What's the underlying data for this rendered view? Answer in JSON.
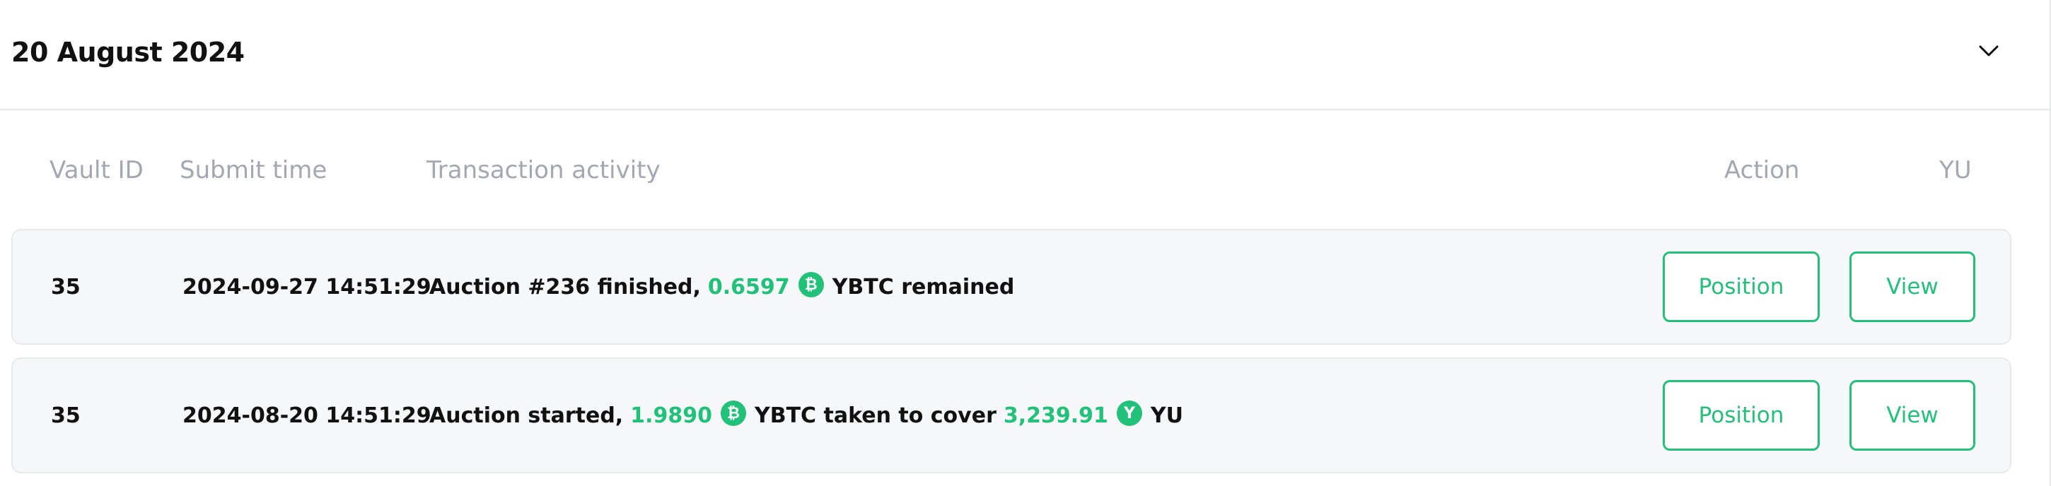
{
  "header": {
    "date": "20 August 2024",
    "toggle_icon": "chevron-down-icon"
  },
  "columns": {
    "vault_id": "Vault ID",
    "submit_time": "Submit time",
    "transaction_activity": "Transaction activity",
    "action": "Action",
    "yu": "YU"
  },
  "rows": [
    {
      "vault_id": "35",
      "submit_time": "2024-09-27 14:51:29",
      "activity": {
        "prefix": "Auction #236 finished,",
        "amount1": "0.6597",
        "coin1_icon": "bitcoin-icon",
        "coin1_glyph": "₿",
        "middle": "YBTC remained",
        "amount2": "",
        "coin2_icon": "",
        "suffix": ""
      },
      "action_label": "Position",
      "yu_label": "View"
    },
    {
      "vault_id": "35",
      "submit_time": "2024-08-20 14:51:29",
      "activity": {
        "prefix": "Auction started,",
        "amount1": "1.9890",
        "coin1_icon": "bitcoin-icon",
        "coin1_glyph": "₿",
        "middle": "YBTC taken to cover",
        "amount2": "3,239.91",
        "coin2_icon": "yu-coin-icon",
        "coin2_glyph": "Y",
        "suffix": "YU"
      },
      "action_label": "Position",
      "yu_label": "View"
    }
  ],
  "colors": {
    "accent": "#21c17a",
    "row_bg": "#f6f7f9",
    "header_text": "#a2a7b2"
  }
}
